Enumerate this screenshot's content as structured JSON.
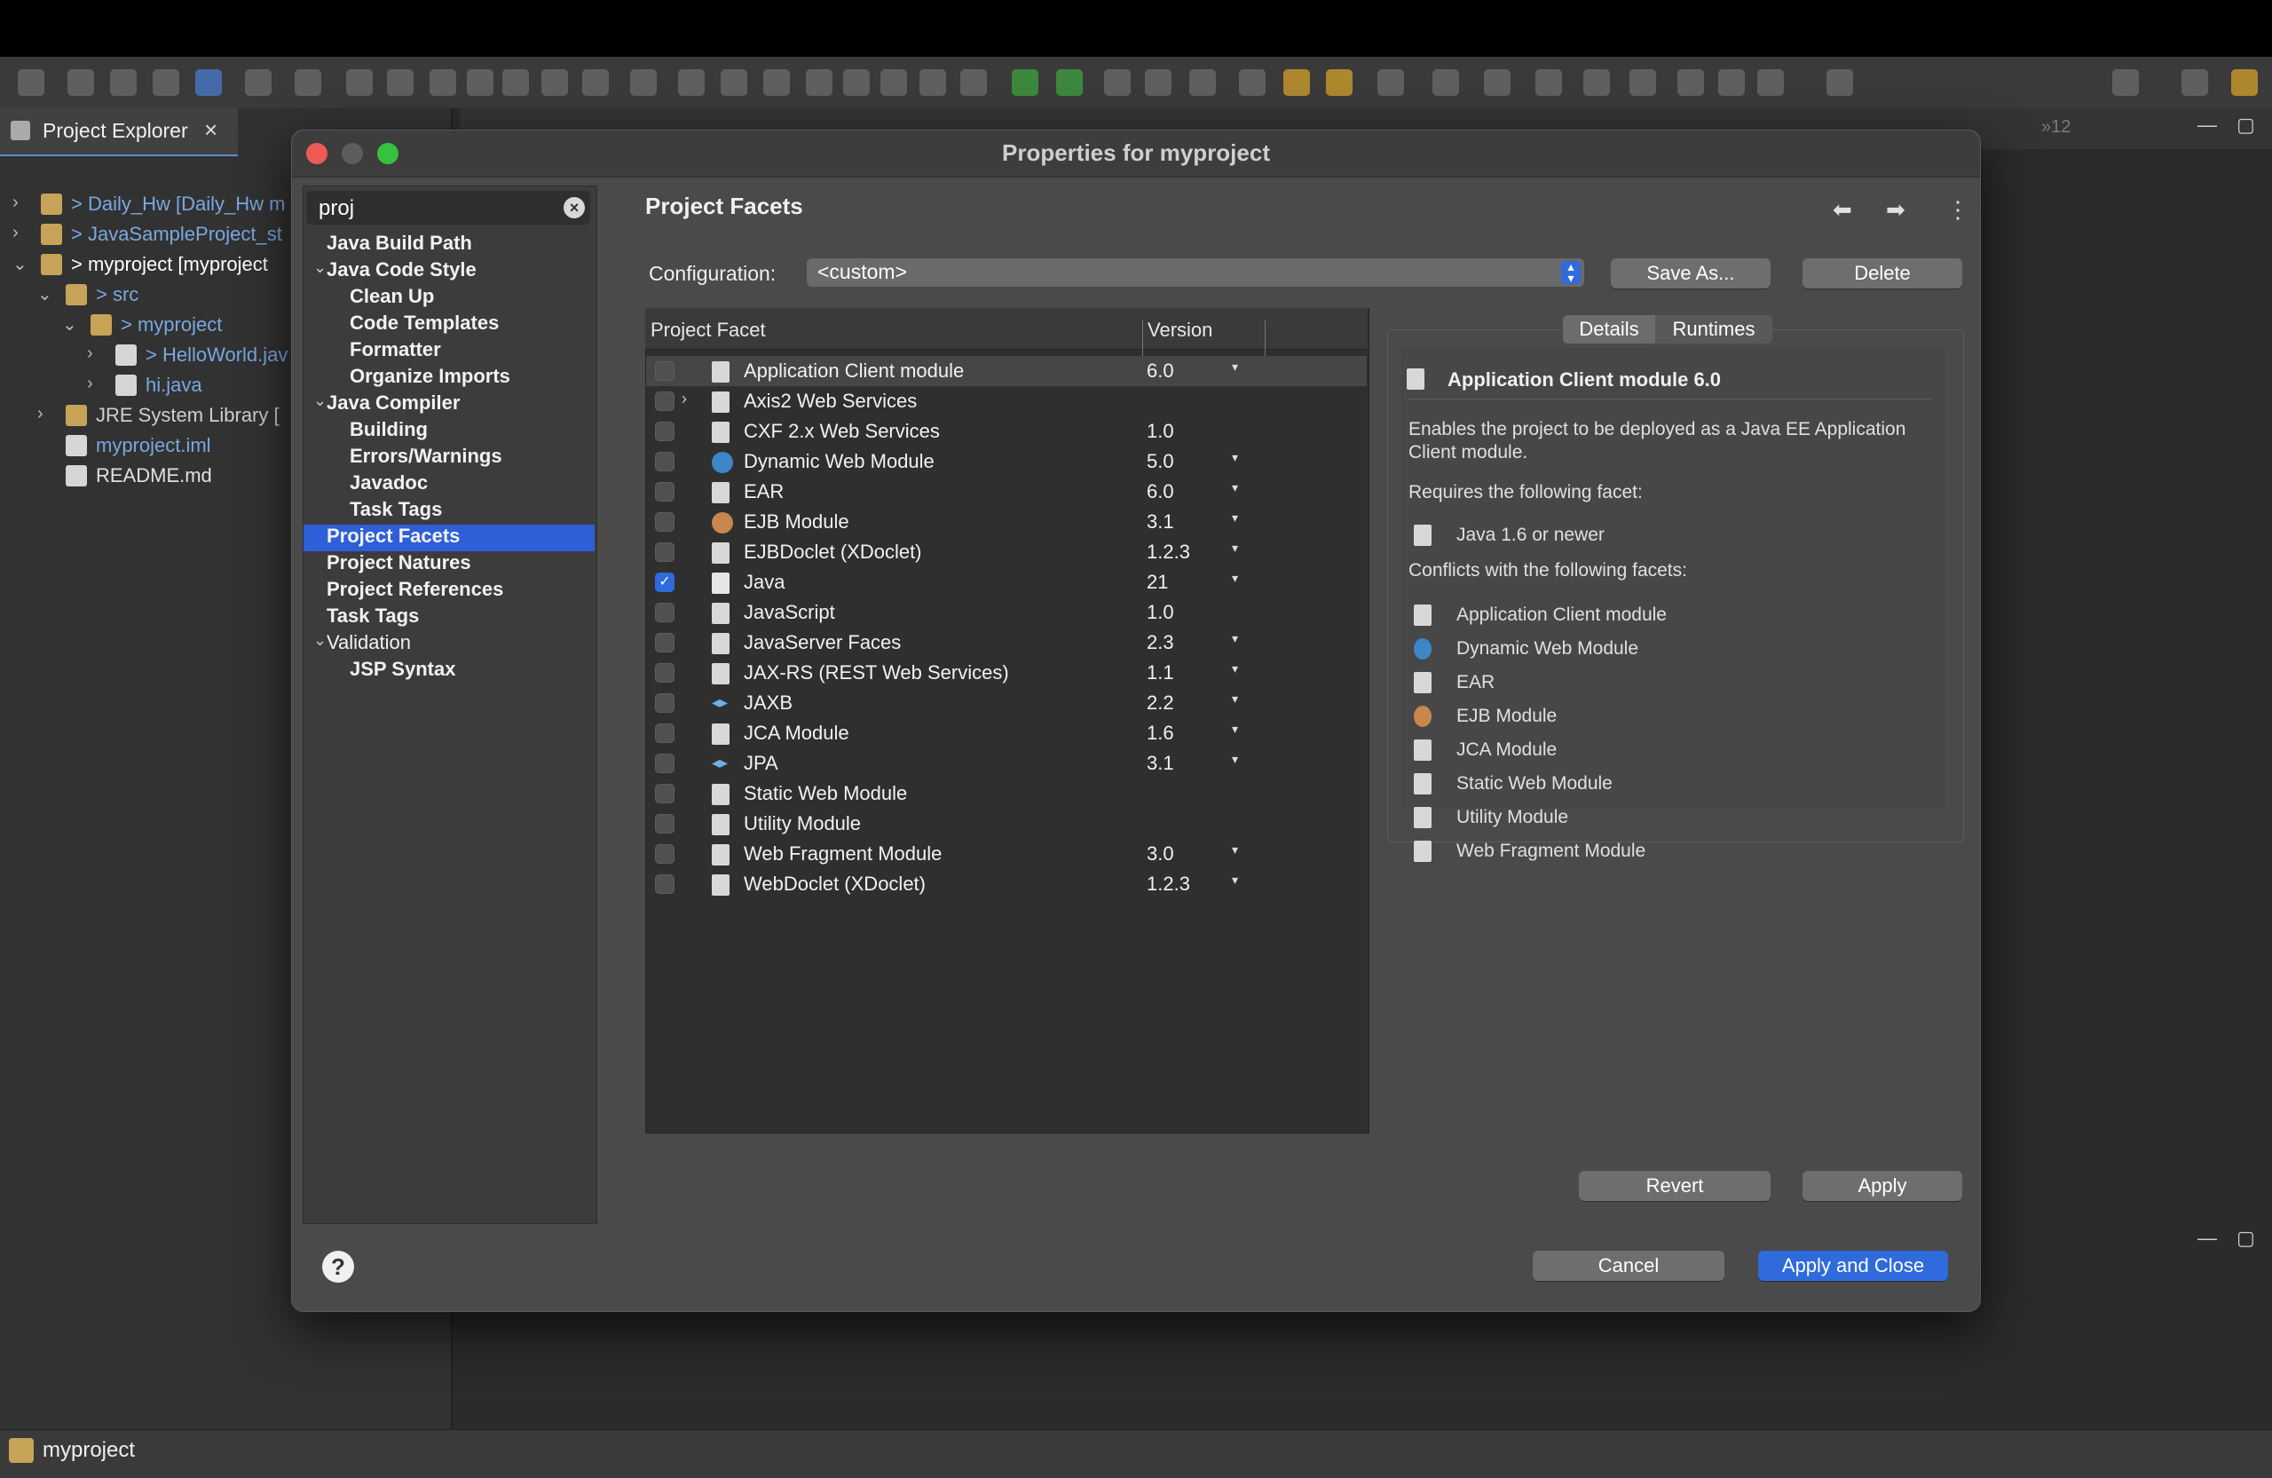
{
  "project_explorer": {
    "tab_label": "Project Explorer",
    "close_glyph": "×",
    "tree": [
      {
        "label": "> Daily_Hw [Daily_Hw m",
        "icon": "project-icon",
        "chevron": ">"
      },
      {
        "label": "> JavaSampleProject_st",
        "icon": "project-icon",
        "chevron": ">"
      },
      {
        "label": "> myproject [myproject",
        "icon": "project-icon",
        "chevron": "v"
      },
      {
        "label": "> src",
        "icon": "folder-icon",
        "chevron": "v"
      },
      {
        "label": "> myproject",
        "icon": "package-icon",
        "chevron": "v"
      },
      {
        "label": "> HelloWorld.jav",
        "icon": "java-file-icon",
        "chevron": ">"
      },
      {
        "label": "hi.java",
        "icon": "java-file-icon",
        "chevron": ">"
      },
      {
        "label": "JRE System Library [",
        "icon": "library-icon",
        "chevron": ">"
      },
      {
        "label": "myproject.iml",
        "icon": "xml-file-icon",
        "chevron": ""
      },
      {
        "label": "README.md",
        "icon": "md-file-icon",
        "chevron": ""
      }
    ]
  },
  "editor": {
    "overflow_count": "»12"
  },
  "status": {
    "project": "myproject"
  },
  "dialog": {
    "title": "Properties for myproject",
    "filter_value": "proj",
    "clear_glyph": "×",
    "nav": [
      {
        "label": "Java Build Path",
        "level": 1,
        "bold": true,
        "chevron": ""
      },
      {
        "label": "Java Code Style",
        "level": 1,
        "bold": true,
        "chevron": "v"
      },
      {
        "label": "Clean Up",
        "level": 2,
        "bold": true,
        "chevron": ""
      },
      {
        "label": "Code Templates",
        "level": 2,
        "bold": true,
        "chevron": ""
      },
      {
        "label": "Formatter",
        "level": 2,
        "bold": true,
        "chevron": ""
      },
      {
        "label": "Organize Imports",
        "level": 2,
        "bold": true,
        "chevron": ""
      },
      {
        "label": "Java Compiler",
        "level": 1,
        "bold": true,
        "chevron": "v"
      },
      {
        "label": "Building",
        "level": 2,
        "bold": true,
        "chevron": ""
      },
      {
        "label": "Errors/Warnings",
        "level": 2,
        "bold": true,
        "chevron": ""
      },
      {
        "label": "Javadoc",
        "level": 2,
        "bold": true,
        "chevron": ""
      },
      {
        "label": "Task Tags",
        "level": 2,
        "bold": true,
        "chevron": ""
      },
      {
        "label": "Project Facets",
        "level": 1,
        "bold": true,
        "chevron": "",
        "selected": true
      },
      {
        "label": "Project Natures",
        "level": 1,
        "bold": true,
        "chevron": ""
      },
      {
        "label": "Project References",
        "level": 1,
        "bold": true,
        "chevron": ""
      },
      {
        "label": "Task Tags",
        "level": 1,
        "bold": true,
        "chevron": ""
      },
      {
        "label": "Validation",
        "level": 1,
        "bold": false,
        "chevron": "v"
      },
      {
        "label": "JSP Syntax",
        "level": 2,
        "bold": true,
        "chevron": ""
      }
    ],
    "content_title": "Project Facets",
    "nav_back": "⬅",
    "nav_forward": "➡",
    "nav_more": "⋮",
    "configuration_label": "Configuration:",
    "configuration_value": "<custom>",
    "save_as": "Save As...",
    "delete": "Delete",
    "table_headers": {
      "facet": "Project Facet",
      "version": "Version"
    },
    "facets": [
      {
        "name": "Application Client module",
        "version": "6.0",
        "dropdown": true,
        "checked": false,
        "icon": "page",
        "highlight": true
      },
      {
        "name": "Axis2 Web Services",
        "version": "",
        "dropdown": false,
        "checked": false,
        "icon": "page",
        "expand": true
      },
      {
        "name": "CXF 2.x Web Services",
        "version": "1.0",
        "dropdown": false,
        "checked": false,
        "icon": "page"
      },
      {
        "name": "Dynamic Web Module",
        "version": "5.0",
        "dropdown": true,
        "checked": false,
        "icon": "dyn"
      },
      {
        "name": "EAR",
        "version": "6.0",
        "dropdown": true,
        "checked": false,
        "icon": "page"
      },
      {
        "name": "EJB Module",
        "version": "3.1",
        "dropdown": true,
        "checked": false,
        "icon": "ejb"
      },
      {
        "name": "EJBDoclet (XDoclet)",
        "version": "1.2.3",
        "dropdown": true,
        "checked": false,
        "icon": "page"
      },
      {
        "name": "Java",
        "version": "21",
        "dropdown": true,
        "checked": true,
        "icon": "java"
      },
      {
        "name": "JavaScript",
        "version": "1.0",
        "dropdown": false,
        "checked": false,
        "icon": "page"
      },
      {
        "name": "JavaServer Faces",
        "version": "2.3",
        "dropdown": true,
        "checked": false,
        "icon": "page"
      },
      {
        "name": "JAX-RS (REST Web Services)",
        "version": "1.1",
        "dropdown": true,
        "checked": false,
        "icon": "page"
      },
      {
        "name": "JAXB",
        "version": "2.2",
        "dropdown": true,
        "checked": false,
        "icon": "jaxb"
      },
      {
        "name": "JCA Module",
        "version": "1.6",
        "dropdown": true,
        "checked": false,
        "icon": "page"
      },
      {
        "name": "JPA",
        "version": "3.1",
        "dropdown": true,
        "checked": false,
        "icon": "jaxb"
      },
      {
        "name": "Static Web Module",
        "version": "",
        "dropdown": false,
        "checked": false,
        "icon": "page"
      },
      {
        "name": "Utility Module",
        "version": "",
        "dropdown": false,
        "checked": false,
        "icon": "page"
      },
      {
        "name": "Web Fragment Module",
        "version": "3.0",
        "dropdown": true,
        "checked": false,
        "icon": "page"
      },
      {
        "name": "WebDoclet (XDoclet)",
        "version": "1.2.3",
        "dropdown": true,
        "checked": false,
        "icon": "page"
      }
    ],
    "tabs": {
      "details": "Details",
      "runtimes": "Runtimes"
    },
    "details": {
      "title": "Application Client module 6.0",
      "description": "Enables the project to be deployed as a Java EE Application Client module.",
      "requires_label": "Requires the following facet:",
      "requires": [
        "Java 1.6 or newer"
      ],
      "conflicts_label": "Conflicts with the following facets:",
      "conflicts": [
        {
          "name": "Application Client module",
          "icon": "page"
        },
        {
          "name": "Dynamic Web Module",
          "icon": "dyn"
        },
        {
          "name": "EAR",
          "icon": "page"
        },
        {
          "name": "EJB Module",
          "icon": "ejb"
        },
        {
          "name": "JCA Module",
          "icon": "page"
        },
        {
          "name": "Static Web Module",
          "icon": "page"
        },
        {
          "name": "Utility Module",
          "icon": "page"
        },
        {
          "name": "Web Fragment Module",
          "icon": "page"
        }
      ]
    },
    "revert": "Revert",
    "apply": "Apply",
    "cancel": "Cancel",
    "apply_close": "Apply and Close",
    "help_glyph": "?"
  }
}
